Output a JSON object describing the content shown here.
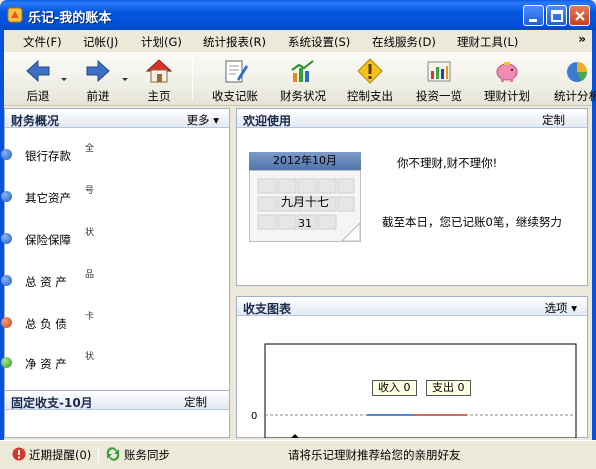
{
  "window": {
    "title": "乐记-我的账本"
  },
  "menu": [
    {
      "label": "文件(F)"
    },
    {
      "label": "记帐(J)"
    },
    {
      "label": "计划(G)"
    },
    {
      "label": "统计报表(R)"
    },
    {
      "label": "系统设置(S)"
    },
    {
      "label": "在线服务(D)"
    },
    {
      "label": "理财工具(L)"
    }
  ],
  "menu_more": "»",
  "toolbar": {
    "back": "后退",
    "forward": "前进",
    "home": "主页",
    "record": "收支记账",
    "status": "财务状况",
    "control": "控制支出",
    "invest": "投资一览",
    "plan": "理财计划",
    "analysis": "统计分析"
  },
  "finance": {
    "title": "财务概况",
    "more": "更多",
    "items": [
      {
        "label": "银行存款",
        "frag": "全",
        "color": "#1f5fc6"
      },
      {
        "label": "其它资产",
        "frag": "号",
        "color": "#1f5fc6"
      },
      {
        "label": "保险保障",
        "frag": "状",
        "color": "#1f5fc6"
      },
      {
        "label": "总 资 产",
        "frag": "品",
        "color": "#1f5fc6"
      },
      {
        "label": "总 负 债",
        "frag": "卡",
        "color": "#d04a1c"
      },
      {
        "label": "净 资 产",
        "frag": "状",
        "color": "#3aa52c"
      }
    ]
  },
  "fixed": {
    "title": "固定收支-10月",
    "action": "定制"
  },
  "welcome": {
    "title": "欢迎使用",
    "action": "定制",
    "calendar_month": "2012年10月",
    "calendar_lunar": "九月十七",
    "calendar_day": "31",
    "message": "你不理财,财不理你!",
    "status": "截至本日，您已记账0笔，继续努力"
  },
  "chart": {
    "title": "收支图表",
    "options": "选项",
    "income_label": "收入 0",
    "expense_label": "支出 0",
    "zero_tick": "0"
  },
  "chart_data": {
    "type": "bar",
    "categories": [],
    "series": [
      {
        "name": "收入",
        "values": [
          0
        ]
      },
      {
        "name": "支出",
        "values": [
          0
        ]
      }
    ],
    "yticks": [
      "0"
    ]
  },
  "statusbar": {
    "reminder": "近期提醒(0)",
    "sync": "账务同步",
    "recommend": "请将乐记理财推荐给您的亲朋好友"
  },
  "colors": {
    "titlebar": "#0456e0",
    "panel_border": "#9fb0c8",
    "income_bar": "#1f5fc6",
    "expense_bar": "#c0392b"
  }
}
